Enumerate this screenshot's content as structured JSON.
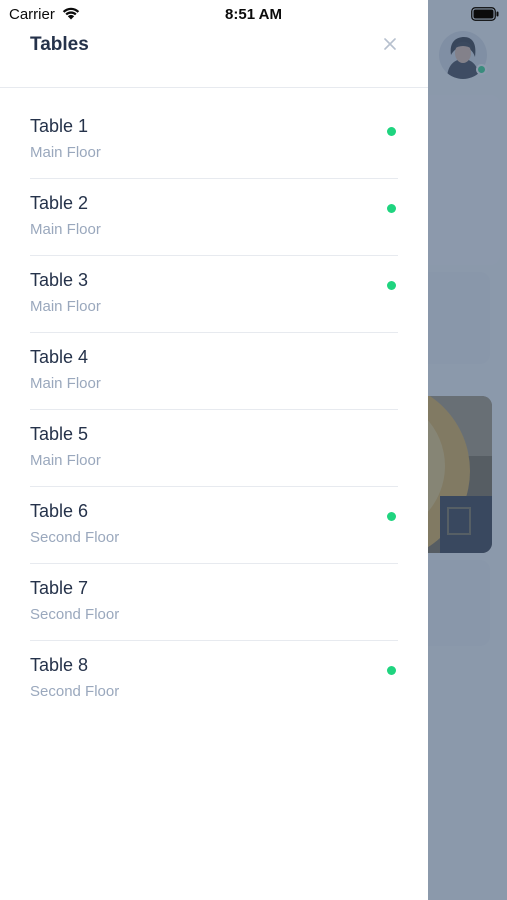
{
  "status_bar": {
    "carrier": "Carrier",
    "time": "8:51 AM"
  },
  "drawer": {
    "title": "Tables",
    "close_icon": "close-icon"
  },
  "colors": {
    "available_dot": "#1fd47f",
    "title_text": "#25324a",
    "subtitle_text": "#9aa8bd"
  },
  "tables": [
    {
      "name": "Table 1",
      "floor": "Main Floor",
      "active": true
    },
    {
      "name": "Table 2",
      "floor": "Main Floor",
      "active": true
    },
    {
      "name": "Table 3",
      "floor": "Main Floor",
      "active": true
    },
    {
      "name": "Table 4",
      "floor": "Main Floor",
      "active": false
    },
    {
      "name": "Table 5",
      "floor": "Main Floor",
      "active": false
    },
    {
      "name": "Table 6",
      "floor": "Second Floor",
      "active": true
    },
    {
      "name": "Table 7",
      "floor": "Second Floor",
      "active": false
    },
    {
      "name": "Table 8",
      "floor": "Second Floor",
      "active": true
    }
  ],
  "background": {
    "avatar_icon": "user-avatar",
    "avatar_status": "online"
  }
}
